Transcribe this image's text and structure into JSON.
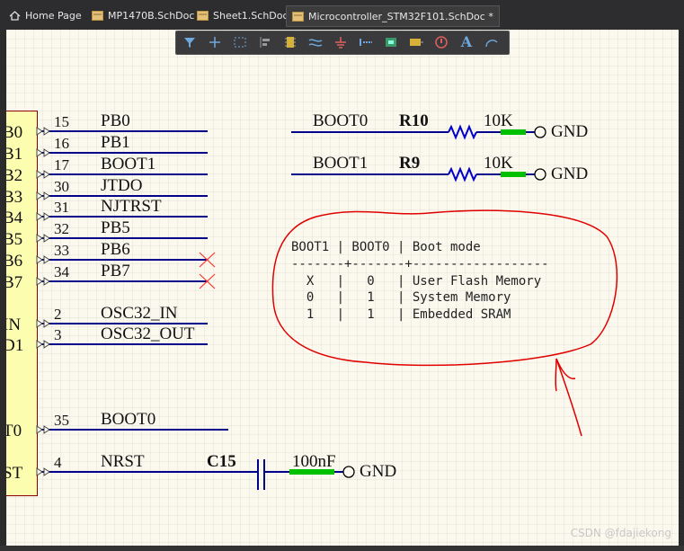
{
  "tabs": [
    {
      "label": "Home Page",
      "icon": "home-icon"
    },
    {
      "label": "MP1470B.SchDoc",
      "icon": "schematic-doc-icon"
    },
    {
      "label": "Sheet1.SchDoc",
      "icon": "schematic-doc-icon"
    },
    {
      "label": "Microcontroller_STM32F101.SchDoc *",
      "icon": "schematic-doc-icon"
    }
  ],
  "toolbar": {
    "tools": [
      "filter-icon",
      "crosshair-icon",
      "select-rect-icon",
      "align-icon",
      "component-icon",
      "wire-icon",
      "ground-icon",
      "port-icon",
      "harness-icon",
      "parameter-icon",
      "directive-icon",
      "text-icon",
      "arc-icon"
    ]
  },
  "chip_pins": [
    {
      "cut_name": "B0",
      "num": "15",
      "net": "PB0"
    },
    {
      "cut_name": "B1",
      "num": "16",
      "net": "PB1"
    },
    {
      "cut_name": "B2",
      "num": "17",
      "net": "BOOT1"
    },
    {
      "cut_name": "B3",
      "num": "30",
      "net": "JTDO"
    },
    {
      "cut_name": "B4",
      "num": "31",
      "net": "NJTRST"
    },
    {
      "cut_name": "B5",
      "num": "32",
      "net": "PB5"
    },
    {
      "cut_name": "B6",
      "num": "33",
      "net": "PB6"
    },
    {
      "cut_name": "B7",
      "num": "34",
      "net": "PB7"
    },
    {
      "cut_name": "IN",
      "num": "2",
      "net": "OSC32_IN"
    },
    {
      "cut_name": "D1",
      "num": "3",
      "net": "OSC32_OUT"
    },
    {
      "cut_name": "T0",
      "num": "35",
      "net": "BOOT0"
    },
    {
      "cut_name": "ST",
      "num": "4",
      "net": "NRST"
    }
  ],
  "resistors": [
    {
      "net": "BOOT0",
      "ref": "R10",
      "value": "10K",
      "gnd": "GND"
    },
    {
      "net": "BOOT1",
      "ref": "R9",
      "value": "10K",
      "gnd": "GND"
    }
  ],
  "capacitor": {
    "ref": "C15",
    "value": "100nF",
    "gnd": "GND"
  },
  "boot_table": {
    "header": "BOOT1 | BOOT0 | Boot mode",
    "rule": "-------+-------+------------------",
    "rows": [
      "  X   |   0   | User Flash Memory",
      "  0   |   1   | System Memory",
      "  1   |   1   | Embedded SRAM"
    ]
  },
  "watermark": "CSDN @fdajiekong",
  "colors": {
    "wire": "#00008b",
    "resistor": "#0000cc",
    "annotation": "#e00000",
    "green": "#00c000",
    "chip_fill": "#fdfdb0"
  }
}
